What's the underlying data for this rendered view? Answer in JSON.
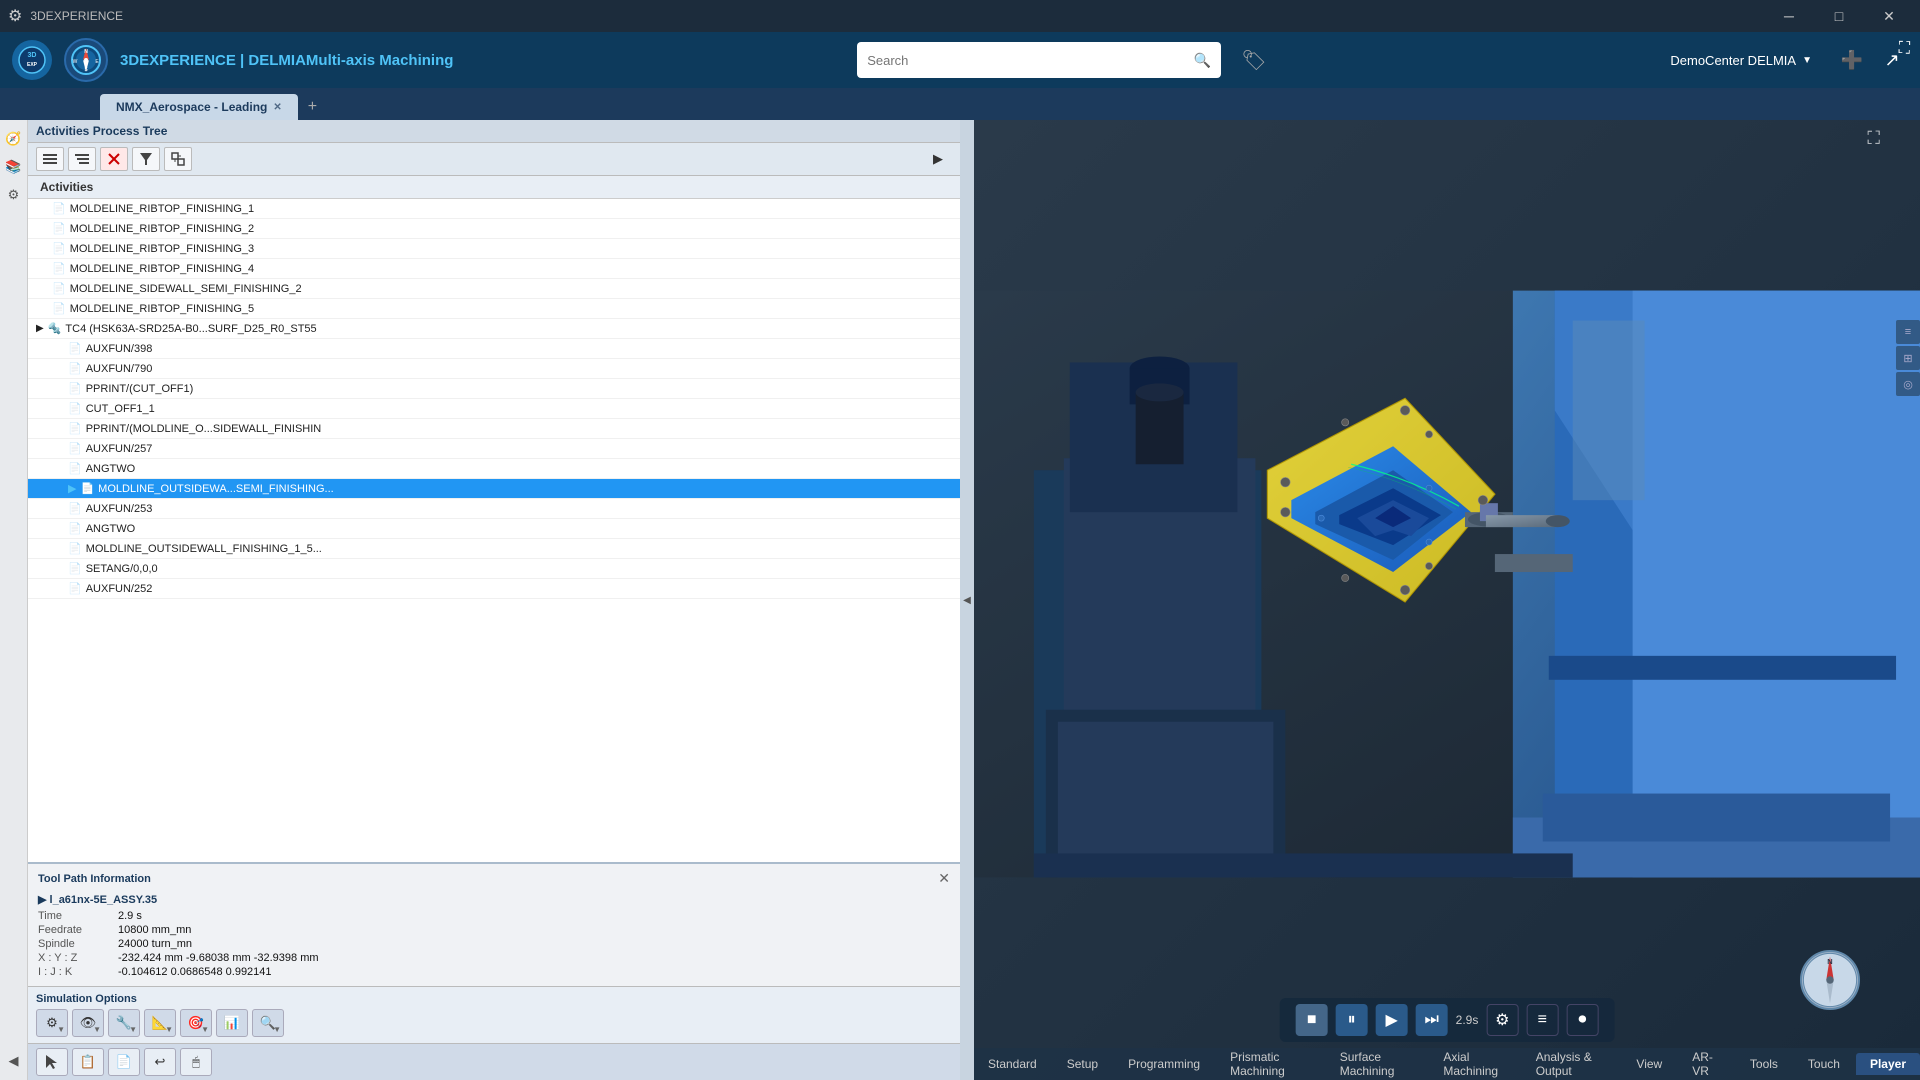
{
  "titlebar": {
    "title": "3DEXPERIENCE",
    "minimize": "─",
    "maximize": "□",
    "close": "✕"
  },
  "header": {
    "app_name": "3DEXPERIENCE",
    "brand": "DELMIA",
    "product": "Multi-axis Machining",
    "search_placeholder": "Search",
    "user": "DemoCenter DELMIA",
    "tab_name": "NMX_Aerospace - Leading",
    "add_tab": "+"
  },
  "activities_panel": {
    "title": "Activities Process Tree",
    "label": "Activities",
    "items": [
      {
        "id": "moldeline_1",
        "label": "MOLDELINE_RIBTOP_FINISHING_1",
        "indent": 1,
        "selected": false
      },
      {
        "id": "moldeline_2",
        "label": "MOLDELINE_RIBTOP_FINISHING_2",
        "indent": 1,
        "selected": false
      },
      {
        "id": "moldeline_3",
        "label": "MOLDELINE_RIBTOP_FINISHING_3",
        "indent": 1,
        "selected": false
      },
      {
        "id": "moldeline_4",
        "label": "MOLDELINE_RIBTOP_FINISHING_4",
        "indent": 1,
        "selected": false
      },
      {
        "id": "moldeline_sw2",
        "label": "MOLDELINE_SIDEWALL_SEMI_FINISHING_2",
        "indent": 1,
        "selected": false
      },
      {
        "id": "moldeline_5",
        "label": "MOLDELINE_RIBTOP_FINISHING_5",
        "indent": 1,
        "selected": false
      },
      {
        "id": "tc4",
        "label": "TC4 (HSK63A-SRD25A-B0...SURF_D25_R0_ST55",
        "indent": 0,
        "selected": false,
        "expanded": true
      },
      {
        "id": "auxfun398",
        "label": "AUXFUN/398",
        "indent": 2,
        "selected": false
      },
      {
        "id": "auxfun790",
        "label": "AUXFUN/790",
        "indent": 2,
        "selected": false
      },
      {
        "id": "pprint_cutoff1",
        "label": "PPRINT/(CUT_OFF1)",
        "indent": 2,
        "selected": false
      },
      {
        "id": "cut_off1",
        "label": "CUT_OFF1_1",
        "indent": 2,
        "selected": false
      },
      {
        "id": "pprint_mold",
        "label": "PPRINT/(MOLDLINE_O...SIDEWALL_FINISHIN",
        "indent": 2,
        "selected": false
      },
      {
        "id": "auxfun257",
        "label": "AUXFUN/257",
        "indent": 2,
        "selected": false
      },
      {
        "id": "angtwo1",
        "label": "ANGTWO",
        "indent": 2,
        "selected": false
      },
      {
        "id": "moldline_outside_semi",
        "label": "MOLDLINE_OUTSIDEWA...SEMI_FINISHING...",
        "indent": 2,
        "selected": true
      },
      {
        "id": "auxfun253",
        "label": "AUXFUN/253",
        "indent": 2,
        "selected": false
      },
      {
        "id": "angtwo2",
        "label": "ANGTWO",
        "indent": 2,
        "selected": false
      },
      {
        "id": "moldline_outside_fin",
        "label": "MOLDLINE_OUTSIDEWALL_FINISHING_1_5...",
        "indent": 2,
        "selected": false
      },
      {
        "id": "setang",
        "label": "SETANG/0,0,0",
        "indent": 2,
        "selected": false
      },
      {
        "id": "auxfun252",
        "label": "AUXFUN/252",
        "indent": 2,
        "selected": false
      }
    ]
  },
  "toolpath_panel": {
    "title": "Tool Path Information",
    "assembly": "▶ l_a61nx-5E_ASSY.35",
    "rows": [
      {
        "label": "Time",
        "value": "2.9 s"
      },
      {
        "label": "Feedrate",
        "value": "10800 mm_mn"
      },
      {
        "label": "Spindle",
        "value": "24000 turn_mn"
      },
      {
        "label": "X : Y : Z",
        "value": "-232.424 mm  -9.68038 mm  -32.9398 mm"
      },
      {
        "label": "I : J : K",
        "value": "-0.104612  0.0686548  0.992141"
      }
    ]
  },
  "simulation_options": {
    "title": "Simulation Options",
    "buttons": [
      {
        "icon": "⚙",
        "label": "sim-settings",
        "has_dropdown": true
      },
      {
        "icon": "👁",
        "label": "sim-view",
        "has_dropdown": true
      },
      {
        "icon": "🔧",
        "label": "sim-tool",
        "has_dropdown": true
      },
      {
        "icon": "📐",
        "label": "sim-measure",
        "has_dropdown": true
      },
      {
        "icon": "🎯",
        "label": "sim-target",
        "has_dropdown": true
      },
      {
        "icon": "📊",
        "label": "sim-chart",
        "has_dropdown": false
      },
      {
        "icon": "🔍",
        "label": "sim-analyze",
        "has_dropdown": true
      }
    ]
  },
  "viewport_tabs": [
    {
      "id": "standard",
      "label": "Standard",
      "active": false
    },
    {
      "id": "setup",
      "label": "Setup",
      "active": false
    },
    {
      "id": "programming",
      "label": "Programming",
      "active": false
    },
    {
      "id": "prismatic",
      "label": "Prismatic Machining",
      "active": false
    },
    {
      "id": "surface",
      "label": "Surface Machining",
      "active": false
    },
    {
      "id": "axial",
      "label": "Axial Machining",
      "active": false
    },
    {
      "id": "analysis",
      "label": "Analysis & Output",
      "active": false
    },
    {
      "id": "view",
      "label": "View",
      "active": false
    },
    {
      "id": "ar_vr",
      "label": "AR-VR",
      "active": false
    },
    {
      "id": "tools",
      "label": "Tools",
      "active": false
    },
    {
      "id": "touch",
      "label": "Touch",
      "active": false
    },
    {
      "id": "player",
      "label": "Player",
      "active": true
    }
  ],
  "playback": {
    "time": "2.9s",
    "stop_label": "■",
    "pause_label": "⏸",
    "play_label": "▶",
    "skip_label": "⏭",
    "settings_label": "⚙",
    "list_label": "≡",
    "record_label": "⏺"
  },
  "bottom_tools": [
    {
      "icon": "↩",
      "label": "undo-btn"
    },
    {
      "icon": "↪",
      "label": "redo-btn"
    },
    {
      "icon": "📋",
      "label": "clipboard-btn"
    },
    {
      "icon": "🖱",
      "label": "pointer-btn"
    },
    {
      "icon": "📏",
      "label": "measure-btn"
    }
  ]
}
